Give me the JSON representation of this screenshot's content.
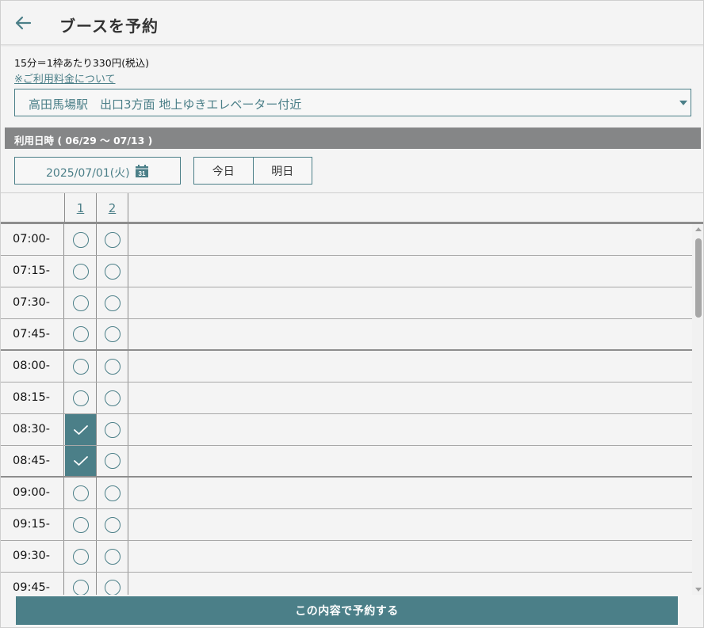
{
  "header": {
    "title": "ブースを予約"
  },
  "pricing": {
    "text": "15分＝1枠あたり330円(税込)",
    "link_label": "※ご利用料金について"
  },
  "location": {
    "selected": "高田馬場駅　出口3方面 地上ゆきエレベーター付近"
  },
  "section": {
    "label": "利用日時 ( 06/29 〜 07/13 )"
  },
  "date": {
    "value": "2025/07/01(火)",
    "calendar_day": "31"
  },
  "day_buttons": {
    "today": "今日",
    "tomorrow": "明日"
  },
  "booths": [
    "1",
    "2"
  ],
  "slots": [
    {
      "time": "07:00-",
      "booth1": "available",
      "booth2": "available"
    },
    {
      "time": "07:15-",
      "booth1": "available",
      "booth2": "available"
    },
    {
      "time": "07:30-",
      "booth1": "available",
      "booth2": "available"
    },
    {
      "time": "07:45-",
      "booth1": "available",
      "booth2": "available"
    },
    {
      "time": "08:00-",
      "booth1": "available",
      "booth2": "available"
    },
    {
      "time": "08:15-",
      "booth1": "available",
      "booth2": "available"
    },
    {
      "time": "08:30-",
      "booth1": "selected",
      "booth2": "available"
    },
    {
      "time": "08:45-",
      "booth1": "selected",
      "booth2": "available"
    },
    {
      "time": "09:00-",
      "booth1": "available",
      "booth2": "available"
    },
    {
      "time": "09:15-",
      "booth1": "available",
      "booth2": "available"
    },
    {
      "time": "09:30-",
      "booth1": "available",
      "booth2": "available"
    },
    {
      "time": "09:45-",
      "booth1": "available",
      "booth2": "available"
    }
  ],
  "submit": {
    "label": "この内容で予約する"
  },
  "colors": {
    "accent": "#4b7f88",
    "section_bar": "#858687",
    "background": "#f4f4f4"
  },
  "icons": {
    "back": "arrow-left-icon",
    "calendar": "calendar-icon",
    "available": "circle-icon",
    "selected": "check-icon",
    "dropdown": "caret-down-icon"
  }
}
